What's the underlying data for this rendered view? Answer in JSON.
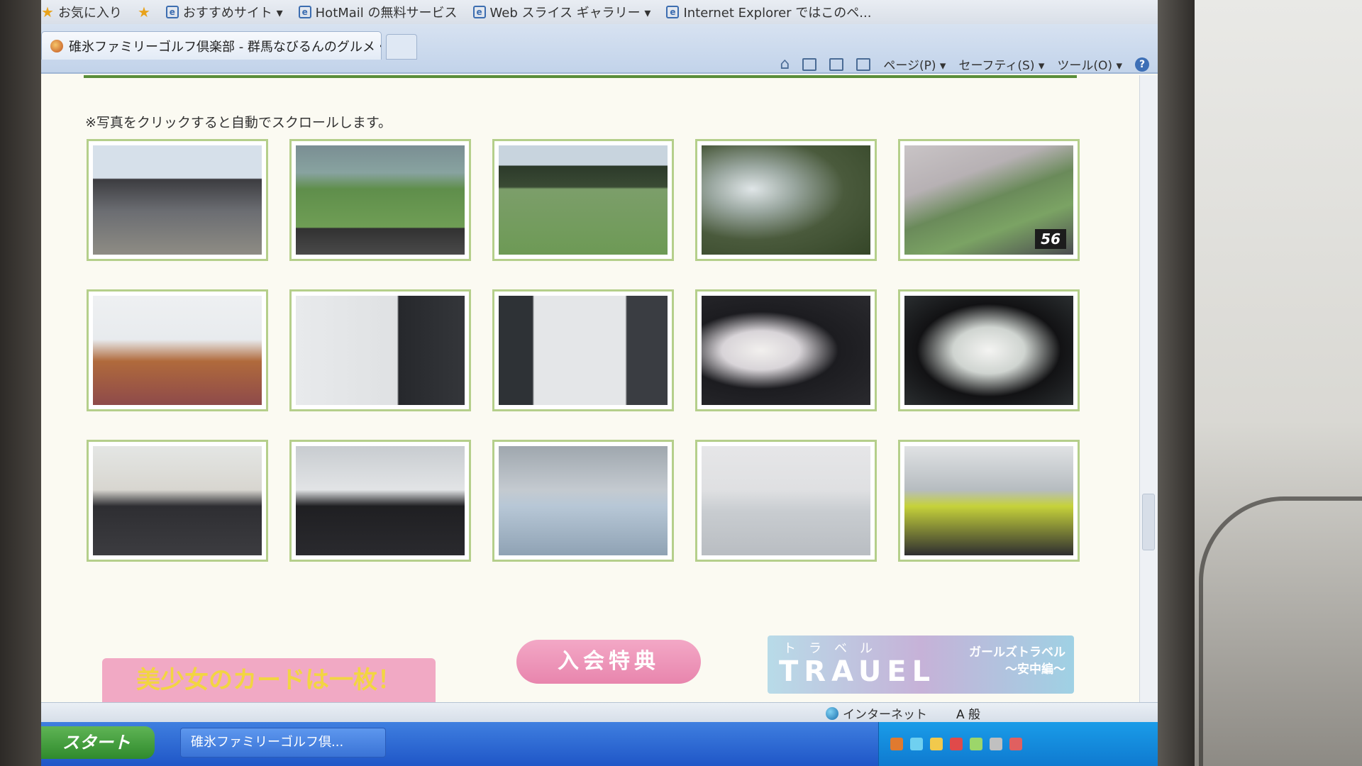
{
  "favorites_bar": {
    "items": [
      {
        "label": "お気に入り"
      },
      {
        "label": "おすすめサイト ▾"
      },
      {
        "label": "HotMail の無料サービス"
      },
      {
        "label": "Web スライス ギャラリー ▾"
      },
      {
        "label": "Internet Explorer ではこのペ..."
      }
    ]
  },
  "tab": {
    "title": "碓氷ファミリーゴルフ倶楽部 - 群馬なびるんのグルメ・イ..."
  },
  "command_bar": {
    "page": "ページ(P) ▾",
    "safety": "セーフティ(S) ▾",
    "tools": "ツール(O) ▾",
    "help": "?"
  },
  "page": {
    "scroll_note": "※写真をクリックすると自動でスクロールします。",
    "badge_56": "56",
    "banner_left": "美少女のカードは一枚！",
    "join_button": "入会特典",
    "travel": {
      "kana": "トラベル",
      "title": "TRAUEL",
      "sub1": "ガールズトラベル",
      "sub2": "～安中編～"
    }
  },
  "status_bar": {
    "zone": "インターネット",
    "ime": "A 般"
  },
  "taskbar": {
    "start": "スタート",
    "task": "碓氷ファミリーゴルフ倶..."
  },
  "colors": {
    "thumb_border": "#b5cf8b",
    "join_button": "#e885ad",
    "taskbar": "#1f56c7"
  }
}
